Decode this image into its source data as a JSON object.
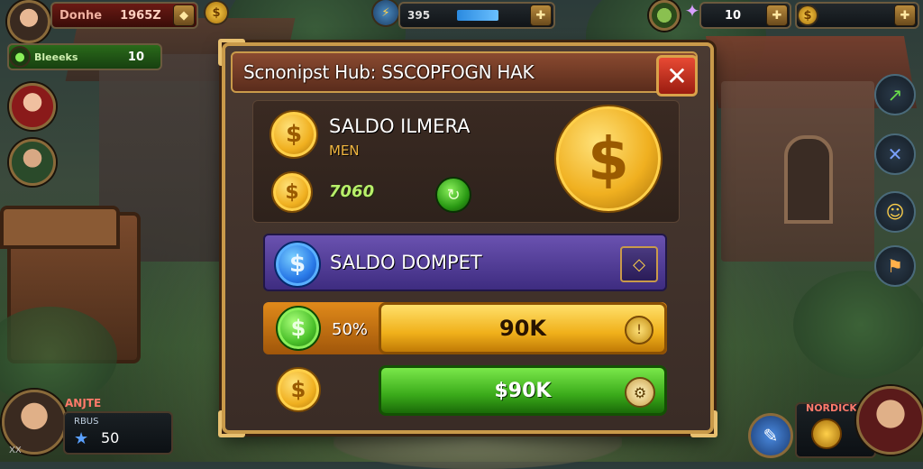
{
  "hud": {
    "player_name": "Donhe",
    "player_value": "1965Z",
    "xp_label": "Bleeeks",
    "xp_value": "10",
    "energy_value": "395",
    "gems_value": "10"
  },
  "dialog": {
    "title": "Scnonipst Hub: SSCOPFOGN HAK",
    "close_label": "✕",
    "balance_label": "SALDO ILMERA",
    "balance_sub": "MEN",
    "balance_value": "7060",
    "wallet_label": "SALDO DOMPET",
    "exchange_percent": "50%",
    "exchange_amount": "90K",
    "buy_amount": "$90K"
  },
  "bottom_left": {
    "name": "ANJTE",
    "rank": "RBUS",
    "count": "50",
    "stars": "XX"
  },
  "bottom_right": {
    "name": "NORDICK"
  },
  "icons": {
    "coin": "dollar-coin-icon",
    "wallet": "blue-dollar-coin-icon",
    "exchange": "green-dollar-coin-icon",
    "close": "close-icon"
  },
  "colors": {
    "frame_gold": "#c99a4a",
    "title_brown": "#8a4a30",
    "wallet_purple": "#6a52b0",
    "exchange_yellow": "#f0b01a",
    "buy_green": "#3aaa1a",
    "close_red": "#e84a34"
  }
}
